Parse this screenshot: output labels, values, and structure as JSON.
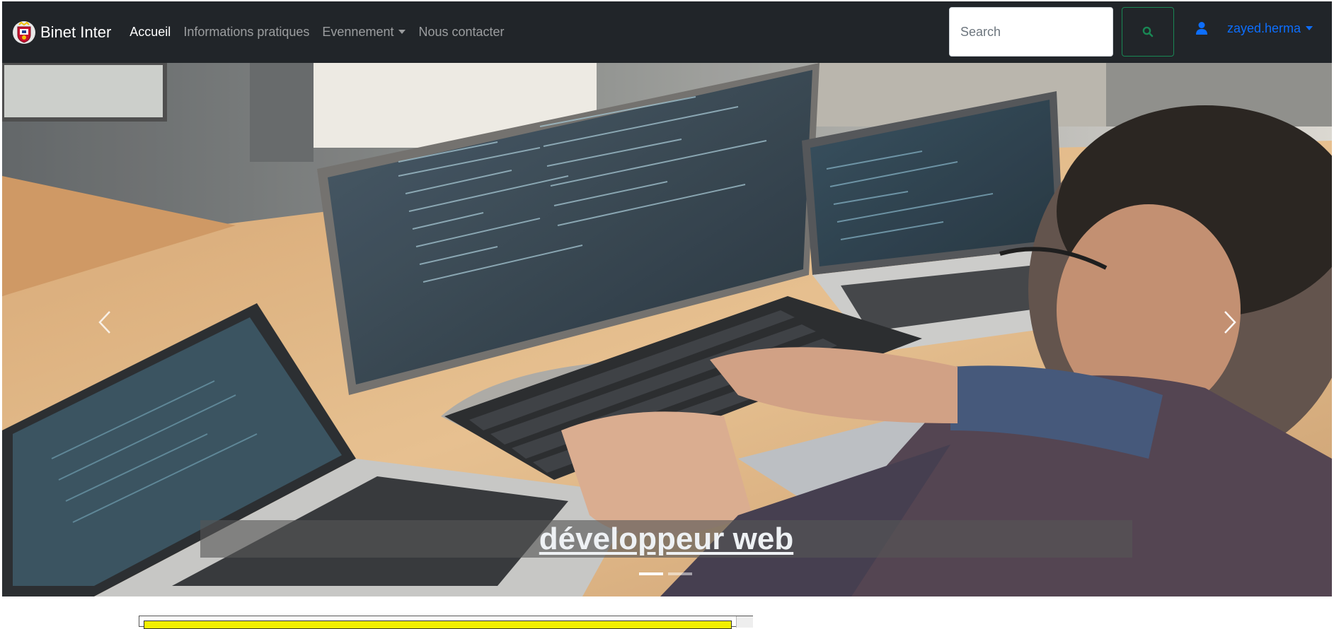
{
  "navbar": {
    "brand": {
      "name": "Binet Inter",
      "logo_icon": "crest-logo-icon"
    },
    "links": [
      {
        "label": "Accueil",
        "active": true
      },
      {
        "label": "Informations pratiques",
        "active": false
      },
      {
        "label": "Evennement",
        "active": false,
        "dropdown": true
      },
      {
        "label": "Nous contacter",
        "active": false
      }
    ],
    "search": {
      "placeholder": "Search",
      "value": "",
      "button_icon": "search-icon"
    },
    "user": {
      "icon": "user-icon",
      "name": "zayed.herma"
    }
  },
  "carousel": {
    "caption": "développeur web",
    "image_icon": "developer-desk-photo",
    "slides": 2,
    "active_slide": 1
  },
  "colors": {
    "navbar_bg": "#212529",
    "nav_active": "#ffffff",
    "nav_inactive": "#a6a9ac",
    "search_button": "#198754",
    "user_link": "#0d6efd",
    "caption_band": "#555555"
  }
}
